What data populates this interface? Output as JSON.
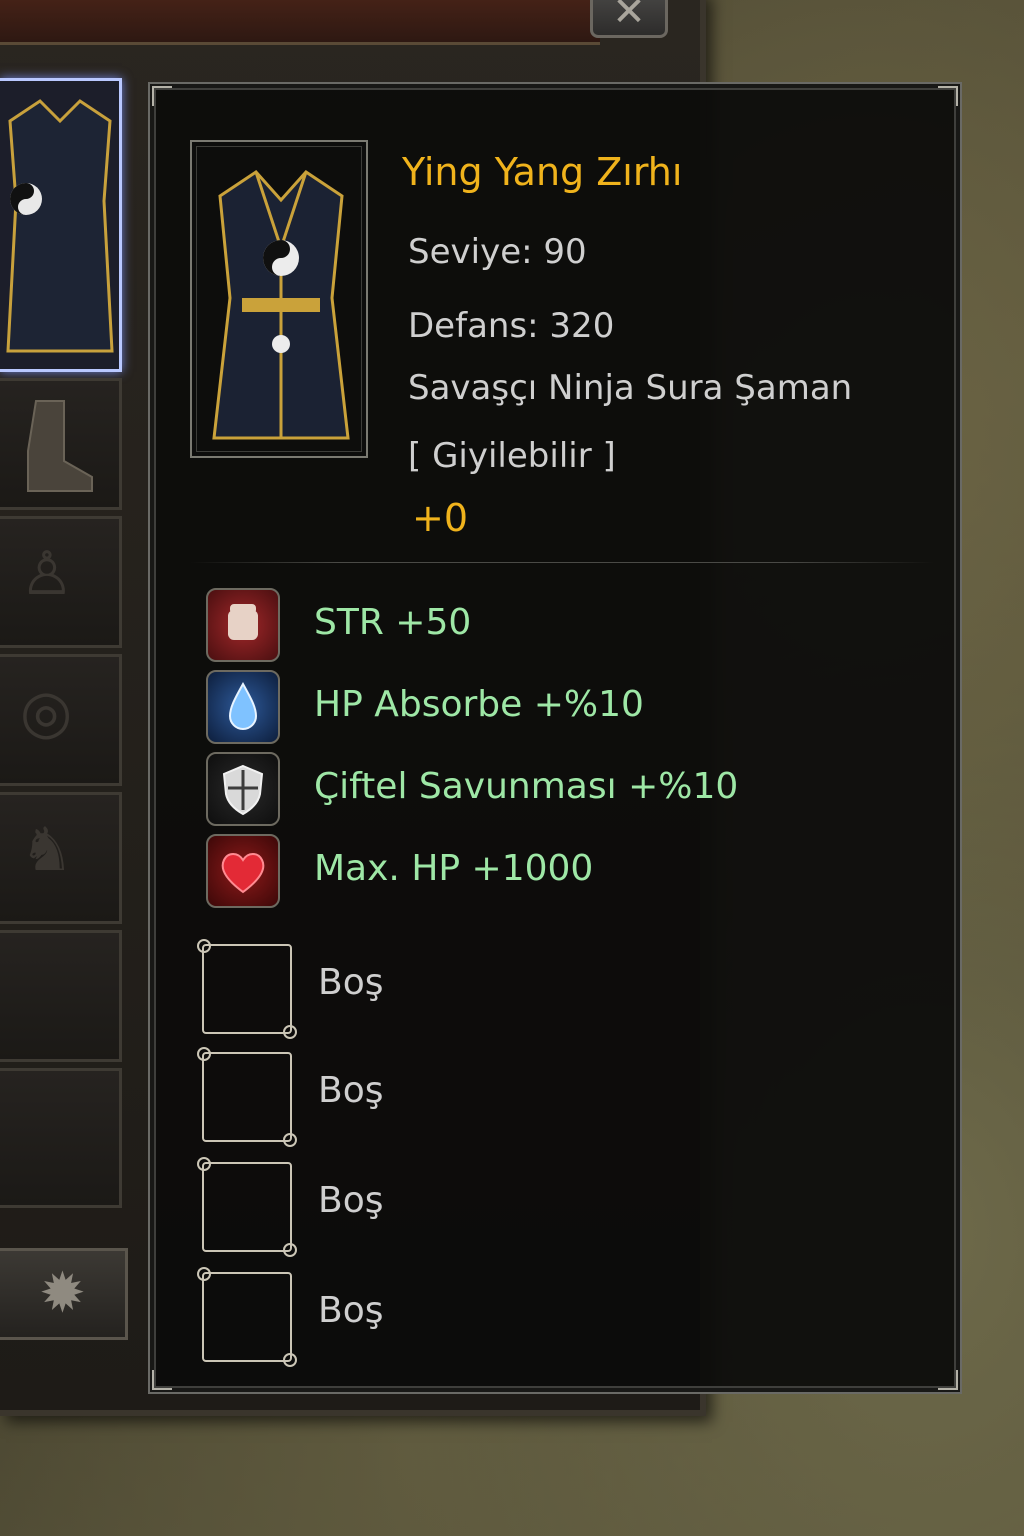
{
  "window": {
    "close_icon": "close-icon",
    "slots": [
      {
        "name": "armor",
        "icon": "armor-icon",
        "active": true
      },
      {
        "name": "boots",
        "icon": "boots-icon",
        "active": false
      },
      {
        "name": "costume",
        "icon": "figure-icon",
        "active": false
      },
      {
        "name": "ring",
        "icon": "ring-icon",
        "active": false
      },
      {
        "name": "stance",
        "icon": "warrior-icon",
        "active": false
      },
      {
        "name": "empty-1",
        "icon": "",
        "active": false
      },
      {
        "name": "empty-2",
        "icon": "",
        "active": false
      }
    ],
    "settings_icon": "gear-icon"
  },
  "tooltip": {
    "item_name": "Ying Yang Zırhı",
    "level": "Seviye: 90",
    "defense": "Defans: 320",
    "classes": "Savaşçı Ninja Sura Şaman",
    "wearable": "[ Giyilebilir ]",
    "upgrade": "+0",
    "bonuses": [
      {
        "icon": "fist-icon",
        "text": "STR  +50"
      },
      {
        "icon": "water-drop-icon",
        "text": "HP Absorbe  +%10"
      },
      {
        "icon": "shield-icon",
        "text": "Çiftel Savunması +%10"
      },
      {
        "icon": "heart-icon",
        "text": "Max. HP  +1000"
      }
    ],
    "sockets": [
      "Boş",
      "Boş",
      "Boş",
      "Boş"
    ]
  },
  "colors": {
    "item_name": "#f0b31c",
    "bonus_text": "#9ee7a6",
    "info_text": "#cfcfcf"
  }
}
